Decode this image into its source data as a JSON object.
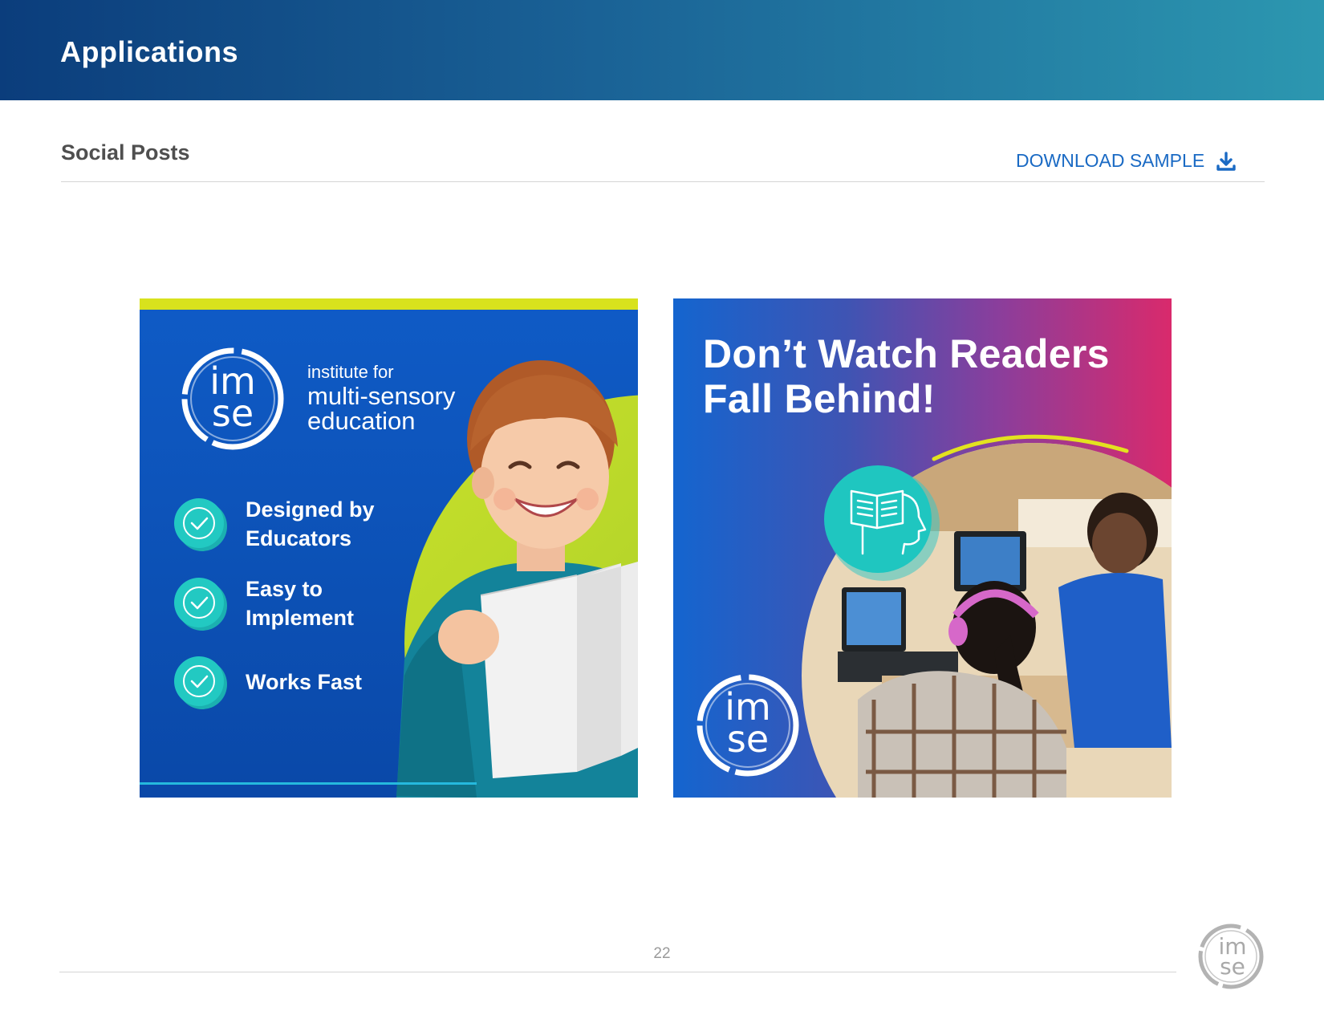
{
  "header": {
    "title": "Applications"
  },
  "section": {
    "title": "Social Posts",
    "download_label": "DOWNLOAD SAMPLE"
  },
  "post1": {
    "logo_letters": [
      "im",
      "se"
    ],
    "tagline": [
      "institute for",
      "multi-sensory",
      "education"
    ],
    "features": [
      {
        "line1": "Designed by",
        "line2": "Educators"
      },
      {
        "line1": "Easy to",
        "line2": "Implement"
      },
      {
        "line1": "Works Fast",
        "line2": ""
      }
    ]
  },
  "post2": {
    "headline_line1": "Don’t Watch Readers",
    "headline_line2": "Fall Behind!",
    "logo_letters": [
      "im",
      "se"
    ]
  },
  "footer": {
    "page_number": "22",
    "logo_letters": [
      "im",
      "se"
    ]
  },
  "colors": {
    "header_start": "#0b3d7c",
    "header_end": "#2c97b0",
    "link": "#1a6ac4",
    "post1_blue": "#0f5bc6",
    "lime": "#d8e21d",
    "teal": "#1fc6c0",
    "magenta": "#d92a6c"
  }
}
